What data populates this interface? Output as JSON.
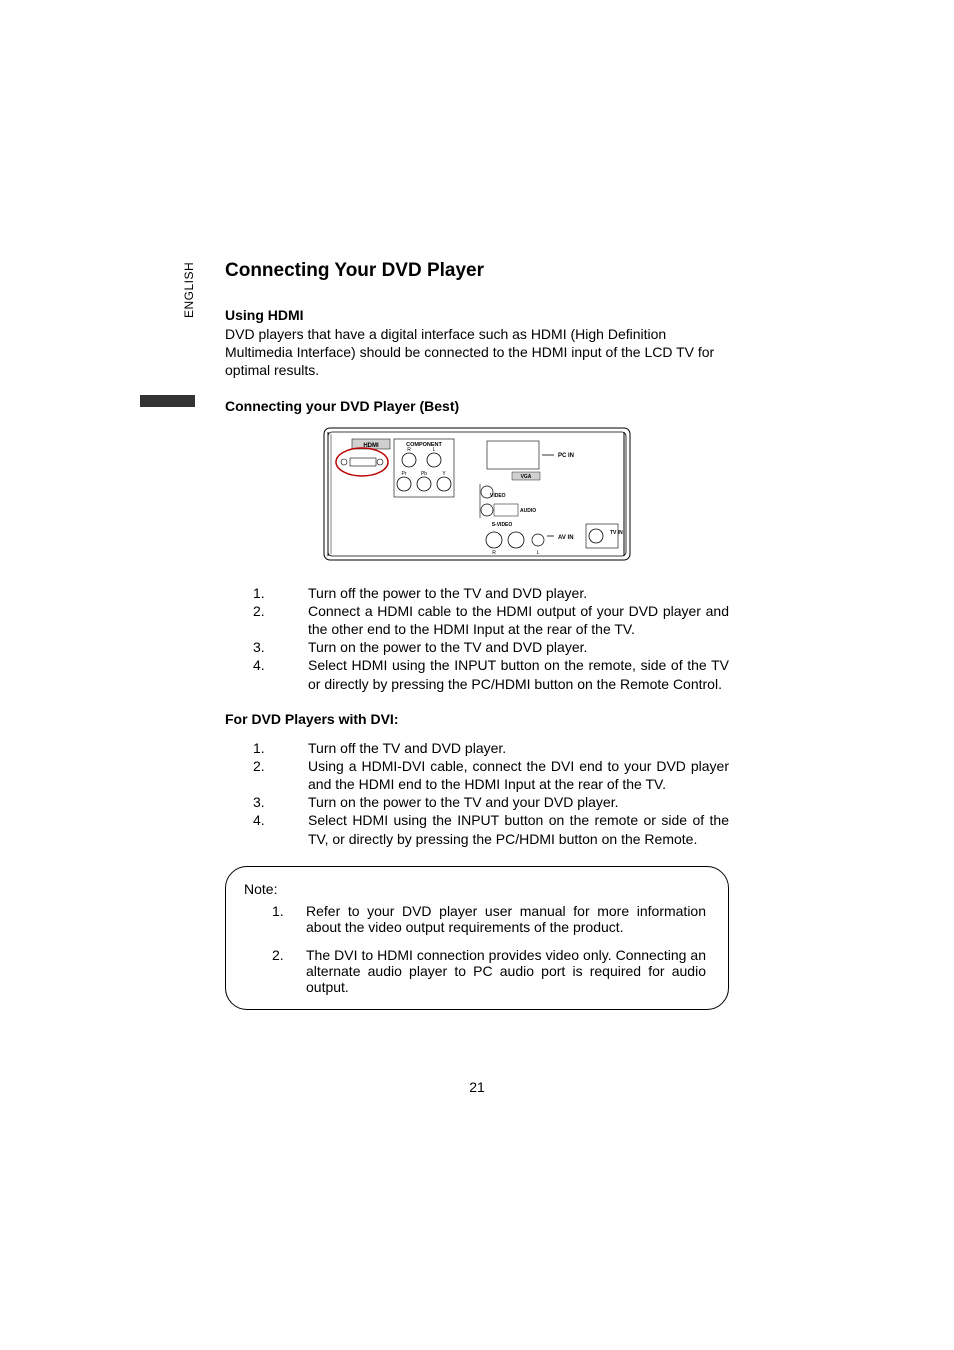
{
  "sideLabel": "ENGLISH",
  "title": "Connecting Your DVD Player",
  "section1": {
    "heading": "Using HDMI",
    "body": "DVD players that have a digital interface such as HDMI (High Definition Multimedia Interface) should be connected to the HDMI input of the LCD TV for optimal results."
  },
  "section2": {
    "heading": "Connecting your DVD Player (Best)"
  },
  "diagram": {
    "hdmi": "HDMI",
    "component": "COMPONENT",
    "r": "R",
    "l": "L",
    "pr": "Pr",
    "pb": "Pb",
    "y": "Y",
    "pcin": "PC IN",
    "vga": "VGA",
    "video": "VIDEO",
    "audio": "AUDIO",
    "svideo": "S-VIDEO",
    "avin": "AV IN",
    "tvin": "TV IN"
  },
  "steps1": [
    {
      "n": "1.",
      "t": "Turn off the power to the TV and DVD player."
    },
    {
      "n": "2.",
      "t": "Connect a HDMI cable to the HDMI output of your DVD player and the other end to the HDMI Input at the rear of the TV."
    },
    {
      "n": "3.",
      "t": "Turn on the power to the TV and DVD player."
    },
    {
      "n": "4.",
      "t": "Select HDMI using the INPUT button on the remote, side of the TV or directly by pressing the PC/HDMI button on the Remote Control."
    }
  ],
  "section3": {
    "heading": "For DVD Players with DVI:"
  },
  "steps2": [
    {
      "n": "1.",
      "t": "Turn off the TV and DVD player."
    },
    {
      "n": "2.",
      "t": "Using a HDMI-DVI cable, connect the DVI end to your DVD player and the HDMI end to the HDMI Input at the rear of the TV."
    },
    {
      "n": "3.",
      "t": "Turn on the power to the TV and your DVD player."
    },
    {
      "n": "4.",
      "t": "Select HDMI using the INPUT button on the remote or side of the TV, or directly by pressing the PC/HDMI button on the Remote."
    }
  ],
  "note": {
    "label": "Note:",
    "items": [
      {
        "n": "1.",
        "t": "Refer to your DVD player user manual for more information about the video output requirements of the product."
      },
      {
        "n": "2.",
        "t": "The DVI to HDMI connection provides video only.  Connecting an alternate audio player to PC audio port is required for audio output."
      }
    ]
  },
  "pageNumber": "21"
}
